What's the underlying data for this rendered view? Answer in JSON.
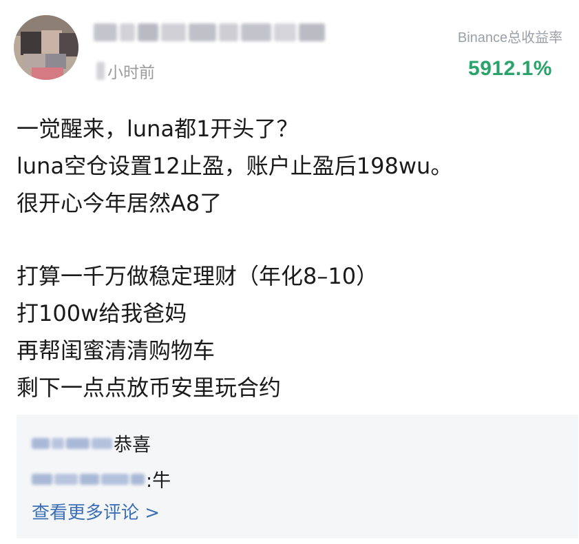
{
  "header": {
    "time_label": "小时前",
    "stat_label": "Binance总收益率",
    "stat_value": "5912.1%",
    "stat_color": "#2aa36b"
  },
  "post": {
    "lines": [
      "一觉醒来，luna都1开头了？",
      "luna空仓设置12止盈，账户止盈后198wu。",
      "很开心今年居然A8了",
      "",
      "打算一千万做稳定理财（年化8–10）",
      "打100w给我爸妈",
      "再帮闺蜜清清购物车",
      "剩下一点点放币安里玩合约"
    ]
  },
  "comments": {
    "items": [
      {
        "text": "恭喜"
      },
      {
        "text": ":牛"
      }
    ],
    "more_label": "查看更多评论 >",
    "link_color": "#3b6fb6"
  }
}
